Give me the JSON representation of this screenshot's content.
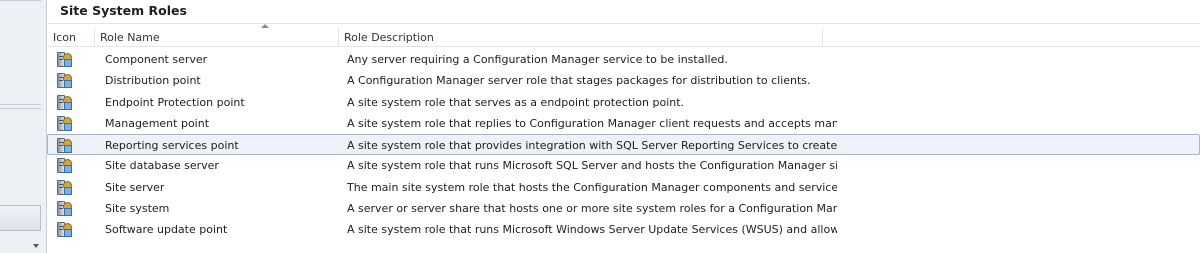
{
  "pane": {
    "title": "Site System Roles"
  },
  "columns": {
    "icon": "Icon",
    "name": "Role Name",
    "description": "Role Description"
  },
  "rows": [
    {
      "name": "Component server",
      "description": "Any server requiring a Configuration Manager service to be installed.",
      "icon": "site-role-icon"
    },
    {
      "name": "Distribution point",
      "description": "A Configuration Manager server role that stages packages for distribution to clients.",
      "icon": "site-role-icon"
    },
    {
      "name": "Endpoint Protection point",
      "description": "A site system role that serves as a endpoint protection point.",
      "icon": "site-role-icon"
    },
    {
      "name": "Management point",
      "description": "A site system role that replies to Configuration Manager client requests and accepts mana...",
      "icon": "site-role-icon"
    },
    {
      "name": "Reporting services point",
      "description": "A site system role that  provides integration with SQL Server Reporting Services to create a...",
      "icon": "site-role-icon",
      "selected": true
    },
    {
      "name": "Site database server",
      "description": "A site system role that runs Microsoft SQL Server and hosts the Configuration Manager sit...",
      "icon": "site-role-icon"
    },
    {
      "name": "Site server",
      "description": "The main site system role that hosts the Configuration Manager components and services.",
      "icon": "site-role-icon"
    },
    {
      "name": "Site system",
      "description": "A server or server share that hosts one or more site system roles for a Configuration Mana...",
      "icon": "site-role-icon"
    },
    {
      "name": "Software update point",
      "description": "A site system role that runs Microsoft Windows Server Update Services (WSUS) and allows...",
      "icon": "site-role-icon"
    }
  ],
  "colors": {
    "selection_bg": "#eef1f7",
    "selection_border": "#a8b4c8",
    "nav_bg": "#edf0f5"
  }
}
